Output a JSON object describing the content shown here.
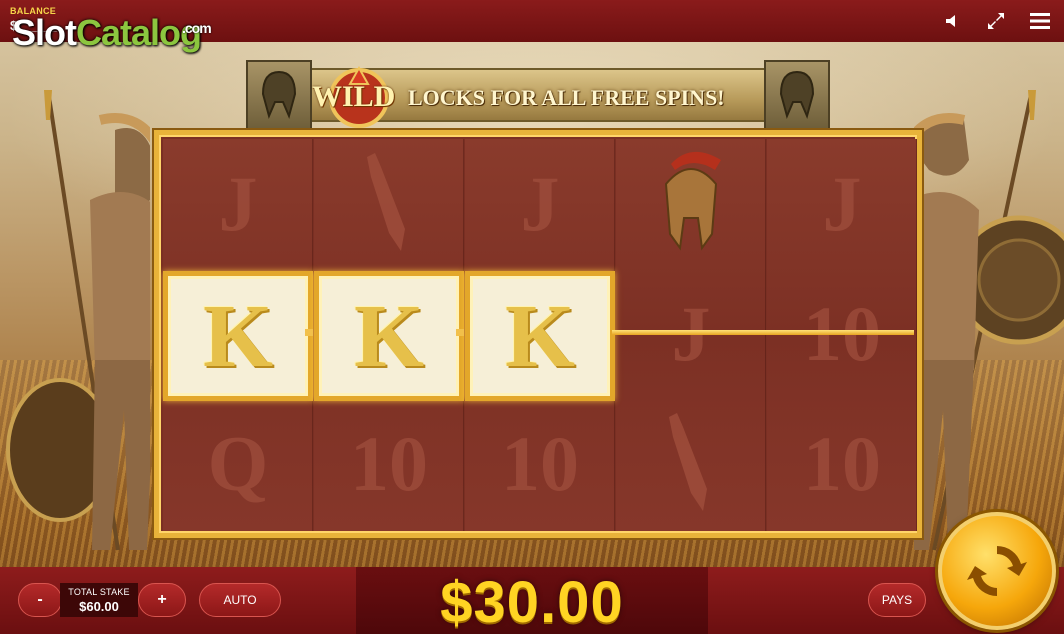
{
  "header": {
    "balance_label": "BALANCE",
    "balance_value": "$___.__",
    "watermark": {
      "slot": "Slot",
      "catalog": "Catalog",
      "com": ".com"
    },
    "icons": [
      "sound-icon",
      "fullscreen-icon",
      "menu-icon"
    ]
  },
  "banner": {
    "wild": "WILD",
    "text": "LOCKS FOR ALL FREE SPINS!"
  },
  "reels": {
    "columns": [
      {
        "top": "J",
        "middle": "K",
        "bottom": "Q"
      },
      {
        "top": "sword",
        "middle": "K",
        "bottom": "10"
      },
      {
        "top": "J",
        "middle": "K",
        "bottom": "10"
      },
      {
        "top": "helmet",
        "middle": "J",
        "bottom": "sword"
      },
      {
        "top": "J",
        "middle": "10",
        "bottom": "10"
      }
    ],
    "winning_symbol": "K",
    "winning_count": 3
  },
  "controls": {
    "minus": "-",
    "plus": "+",
    "stake_label": "TOTAL STAKE",
    "stake_value": "$60.00",
    "auto": "AUTO",
    "pays": "PAYS",
    "win_amount": "$30.00"
  },
  "colors": {
    "bar": "#8a1b1b",
    "gold": "#e8b33a",
    "win_text": "#ffd423",
    "watermark_green": "#8cc63f"
  }
}
